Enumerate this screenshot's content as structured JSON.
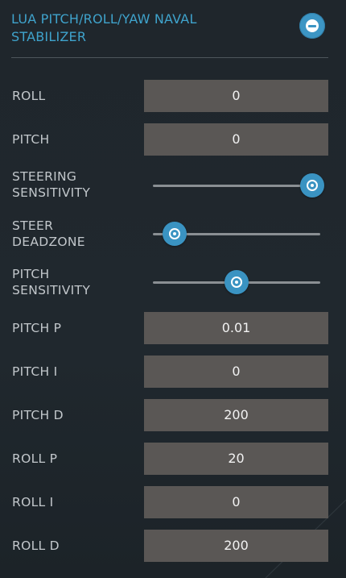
{
  "header": {
    "title_line1": "LUA PITCH/ROLL/YAW NAVAL",
    "title_line2": "STABILIZER",
    "collapse_icon": "minus-circle-icon"
  },
  "colors": {
    "accent": "#3a93c2",
    "title": "#3fa3cc",
    "field_bg": "#5a5755",
    "panel_bg": "#20272d",
    "label": "#c2c7cb"
  },
  "fields": {
    "roll": {
      "label": "ROLL",
      "value": "0"
    },
    "pitch": {
      "label": "PITCH",
      "value": "0"
    },
    "pitch_p": {
      "label": "PITCH P",
      "value": "0.01"
    },
    "pitch_i": {
      "label": "PITCH I",
      "value": "0"
    },
    "pitch_d": {
      "label": "PITCH D",
      "value": "200"
    },
    "roll_p": {
      "label": "ROLL P",
      "value": "20"
    },
    "roll_i": {
      "label": "ROLL I",
      "value": "0"
    },
    "roll_d": {
      "label": "ROLL D",
      "value": "200"
    }
  },
  "sliders": {
    "steering_sensitivity": {
      "label_line1": "STEERING",
      "label_line2": "SENSITIVITY",
      "fraction": 0.95
    },
    "steer_deadzone": {
      "label_line1": "STEER",
      "label_line2": "DEADZONE",
      "fraction": 0.13
    },
    "pitch_sensitivity": {
      "label_line1": "PITCH",
      "label_line2": "SENSITIVITY",
      "fraction": 0.5
    }
  }
}
